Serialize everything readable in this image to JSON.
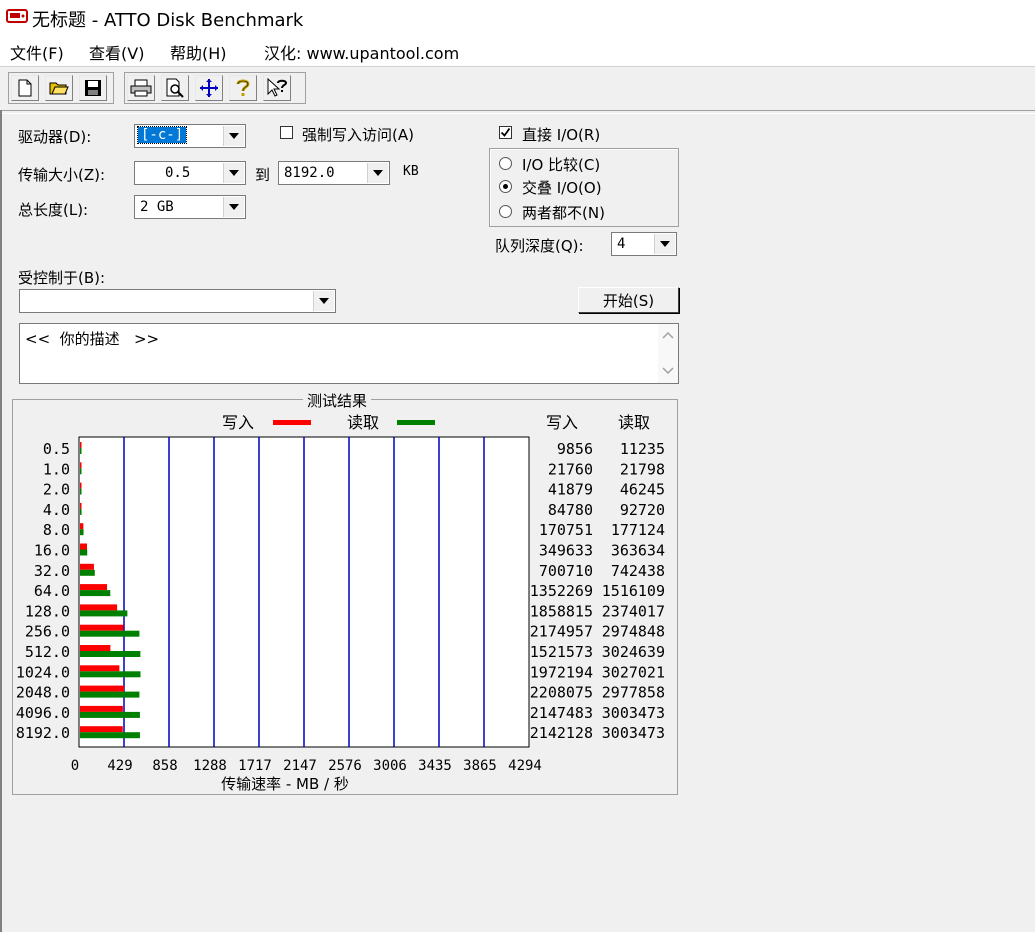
{
  "window": {
    "title": "无标题 - ATTO Disk Benchmark",
    "icon": "disk-benchmark-icon"
  },
  "menu": [
    {
      "label": "文件(F)"
    },
    {
      "label": "查看(V)"
    },
    {
      "label": "帮助(H)"
    },
    {
      "label": "汉化: www.upantool.com"
    }
  ],
  "toolbar": {
    "buttons": [
      "new-icon",
      "open-icon",
      "save-icon",
      "print-icon",
      "print-preview-icon",
      "move-icon",
      "help-icon",
      "context-help-icon"
    ]
  },
  "form": {
    "drive_label": "驱动器(D):",
    "drive_value": "[-c-]",
    "transfer_label": "传输大小(Z):",
    "transfer_from": "0.5",
    "to_label": "到",
    "transfer_to": "8192.0",
    "kb_label": "KB",
    "length_label": "总长度(L):",
    "length_value": "2 GB",
    "force_write_label": "强制写入访问(A)",
    "force_write_checked": false,
    "direct_io_label": "直接 I/O(R)",
    "direct_io_checked": true,
    "io_compare_label": "I/O 比较(C)",
    "overlapped_io_label": "交叠 I/O(O)",
    "neither_label": "两者都不(N)",
    "selected_mode": "overlapped",
    "queue_label": "队列深度(Q):",
    "queue_value": "4",
    "controlled_by_label": "受控制于(B):",
    "controlled_by_value": "",
    "start_button": "开始(S)",
    "description": "<<  你的描述   >>"
  },
  "results": {
    "group_title": "测试结果",
    "legend_write": "写入",
    "legend_read": "读取",
    "col_write": "写入",
    "col_read": "读取",
    "x_axis_label": "传输速率 - MB / 秒",
    "write_color": "#ff0000",
    "read_color": "#008000",
    "grid_color": "#0000c0"
  },
  "chart_data": {
    "type": "bar",
    "orientation": "horizontal",
    "categories": [
      "0.5",
      "1.0",
      "2.0",
      "4.0",
      "8.0",
      "16.0",
      "32.0",
      "64.0",
      "128.0",
      "256.0",
      "512.0",
      "1024.0",
      "2048.0",
      "4096.0",
      "8192.0"
    ],
    "series": [
      {
        "name": "写入",
        "values": [
          9856,
          21760,
          41879,
          84780,
          170751,
          349633,
          700710,
          1352269,
          1858815,
          2174957,
          1521573,
          1972194,
          2208075,
          2147483,
          2142128
        ]
      },
      {
        "name": "读取",
        "values": [
          11235,
          21798,
          46245,
          92720,
          177124,
          363634,
          742438,
          1516109,
          2374017,
          2974848,
          3024639,
          3027021,
          2977858,
          3003473,
          3003473
        ]
      }
    ],
    "bar_values_mb": {
      "write": [
        0.5,
        1,
        4,
        12,
        32,
        67,
        133,
        258,
        354,
        414,
        290,
        376,
        421,
        409,
        408
      ],
      "read": [
        0.5,
        1,
        4,
        15,
        34,
        69,
        141,
        289,
        452,
        567,
        576,
        577,
        567,
        572,
        572
      ]
    },
    "x_ticks": [
      "0",
      "429",
      "858",
      "1288",
      "1717",
      "2147",
      "2576",
      "3006",
      "3435",
      "3865",
      "4294"
    ],
    "xlabel": "传输速率 - MB / 秒",
    "xlim": [
      0,
      4294
    ],
    "bar_scale_max": 4294,
    "grid": true,
    "legend": "top-center"
  }
}
